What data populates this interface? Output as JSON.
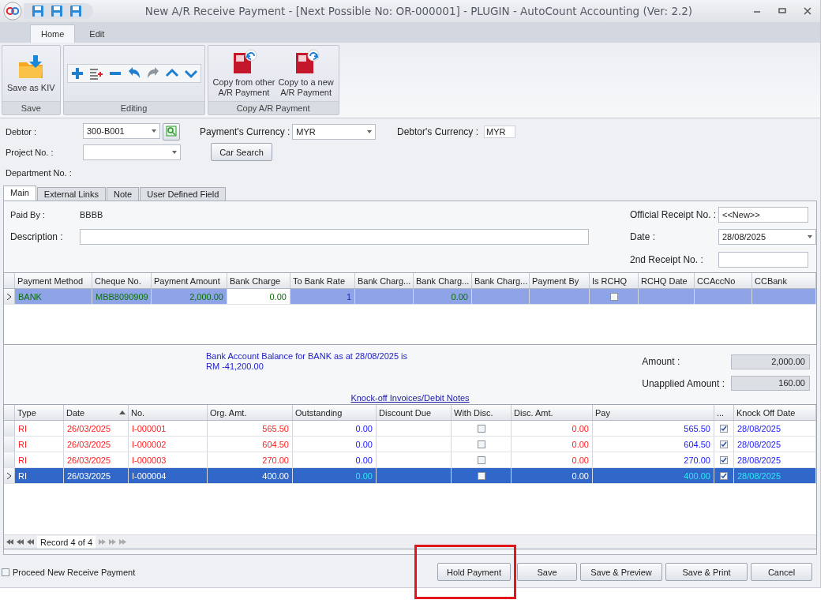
{
  "window": {
    "title": "New A/R Receive Payment - [Next Possible No: OR-000001] - PLUGIN - AutoCount Accounting (Ver: 2.2)"
  },
  "ribbon_tabs": [
    {
      "label": "Home",
      "selected": true
    },
    {
      "label": "Edit",
      "selected": false
    }
  ],
  "ribbon_groups": [
    {
      "title": "Save",
      "kind": "large",
      "buttons": [
        {
          "label": "Save as KIV"
        }
      ]
    },
    {
      "title": "Editing",
      "kind": "strip"
    },
    {
      "title": "Copy A/R Payment",
      "kind": "large",
      "buttons": [
        {
          "label": "Copy from other\nA/R Payment"
        },
        {
          "label": "Copy to a new\nA/R Payment"
        }
      ]
    }
  ],
  "header": {
    "debtor_label": "Debtor :",
    "debtor": "300-B001",
    "project_label": "Project No. :",
    "department_label": "Department No. :",
    "payment_currency_label": "Payment's Currency :",
    "payment_currency": "MYR",
    "car_search": "Car Search",
    "debtor_currency_label": "Debtor's Currency :",
    "debtor_currency": "MYR"
  },
  "tabs": [
    {
      "label": "Main",
      "selected": true
    },
    {
      "label": "External Links",
      "selected": false
    },
    {
      "label": "Note",
      "selected": false
    },
    {
      "label": "User Defined Field",
      "selected": false
    }
  ],
  "main": {
    "paid_by_label": "Paid By :",
    "paid_by": "BBBB",
    "description_label": "Description :",
    "receipt_label": "Official Receipt No. :",
    "receipt": "<<New>>",
    "date_label": "Date :",
    "date": "28/08/2025",
    "second_receipt_label": "2nd Receipt No. :"
  },
  "payment_grid": {
    "columns": [
      {
        "label": "Payment Method",
        "kind": "text"
      },
      {
        "label": "Cheque No.",
        "kind": "text"
      },
      {
        "label": "Payment Amount",
        "kind": "text"
      },
      {
        "label": "Bank Charge",
        "kind": "edit"
      },
      {
        "label": "To Bank Rate",
        "kind": "text"
      },
      {
        "label": "Bank Charg...",
        "kind": "text"
      },
      {
        "label": "Bank Charg...",
        "kind": "text"
      },
      {
        "label": "Bank Charg...",
        "kind": "text"
      },
      {
        "label": "Payment By",
        "kind": "text"
      },
      {
        "label": "Is RCHQ",
        "kind": "check"
      },
      {
        "label": "RCHQ Date",
        "kind": "text"
      },
      {
        "label": "CCAccNo",
        "kind": "text"
      },
      {
        "label": "CCBank",
        "kind": "text"
      }
    ],
    "rows": [
      {
        "selected": true,
        "cells": [
          "BANK",
          "MBB8090909",
          "2,000.00",
          "0.00",
          "1",
          null,
          "0.00",
          null,
          null,
          false,
          null,
          null,
          null
        ]
      }
    ]
  },
  "balance_note": "Bank Account Balance for BANK as at 28/08/2025 is\nRM -41,200.00",
  "amount_label": "Amount :",
  "amount": "2,000.00",
  "unapplied_label": "Unapplied Amount :",
  "unapplied": "160.00",
  "knockoff_link": "Knock-off Invoices/Debit Notes",
  "invoice_grid": {
    "columns": [
      {
        "label": "Type",
        "kind": "text",
        "sorted": false
      },
      {
        "label": "Date",
        "kind": "text",
        "sorted": true
      },
      {
        "label": "No.",
        "kind": "text",
        "sorted": false
      },
      {
        "label": "Org. Amt.",
        "kind": "text",
        "sorted": false
      },
      {
        "label": "Outstanding",
        "kind": "text",
        "sorted": false
      },
      {
        "label": "Discount Due",
        "kind": "text",
        "sorted": false
      },
      {
        "label": "With Disc.",
        "kind": "check",
        "sorted": false
      },
      {
        "label": "Disc. Amt.",
        "kind": "text",
        "sorted": false
      },
      {
        "label": "Pay",
        "kind": "text",
        "sorted": false
      },
      {
        "label": "...",
        "kind": "check",
        "sorted": false
      },
      {
        "label": "Knock Off Date",
        "kind": "text",
        "sorted": false
      }
    ],
    "rows": [
      {
        "selected": false,
        "cells": [
          "RI",
          "26/03/2025",
          "I-000001",
          "565.50",
          "0.00",
          null,
          false,
          "0.00",
          "565.50",
          true,
          "28/08/2025"
        ]
      },
      {
        "selected": false,
        "cells": [
          "RI",
          "26/03/2025",
          "I-000002",
          "604.50",
          "0.00",
          null,
          false,
          "0.00",
          "604.50",
          true,
          "28/08/2025"
        ]
      },
      {
        "selected": false,
        "cells": [
          "RI",
          "26/03/2025",
          "I-000003",
          "270.00",
          "0.00",
          null,
          false,
          "0.00",
          "270.00",
          true,
          "28/08/2025"
        ]
      },
      {
        "selected": true,
        "cells": [
          "RI",
          "26/03/2025",
          "I-000004",
          "400.00",
          "0.00",
          null,
          false,
          "0.00",
          "400.00",
          true,
          "28/08/2025"
        ]
      }
    ],
    "navigator": "Record 4 of 4"
  },
  "proceed": {
    "label": "Proceed New Receive Payment",
    "checked": false
  },
  "buttons": [
    {
      "label": "Hold Payment",
      "highlighted": true
    },
    {
      "label": "Save",
      "highlighted": false
    },
    {
      "label": "Save & Preview",
      "highlighted": false
    },
    {
      "label": "Save & Print",
      "highlighted": false
    },
    {
      "label": "Cancel",
      "highlighted": false
    }
  ]
}
